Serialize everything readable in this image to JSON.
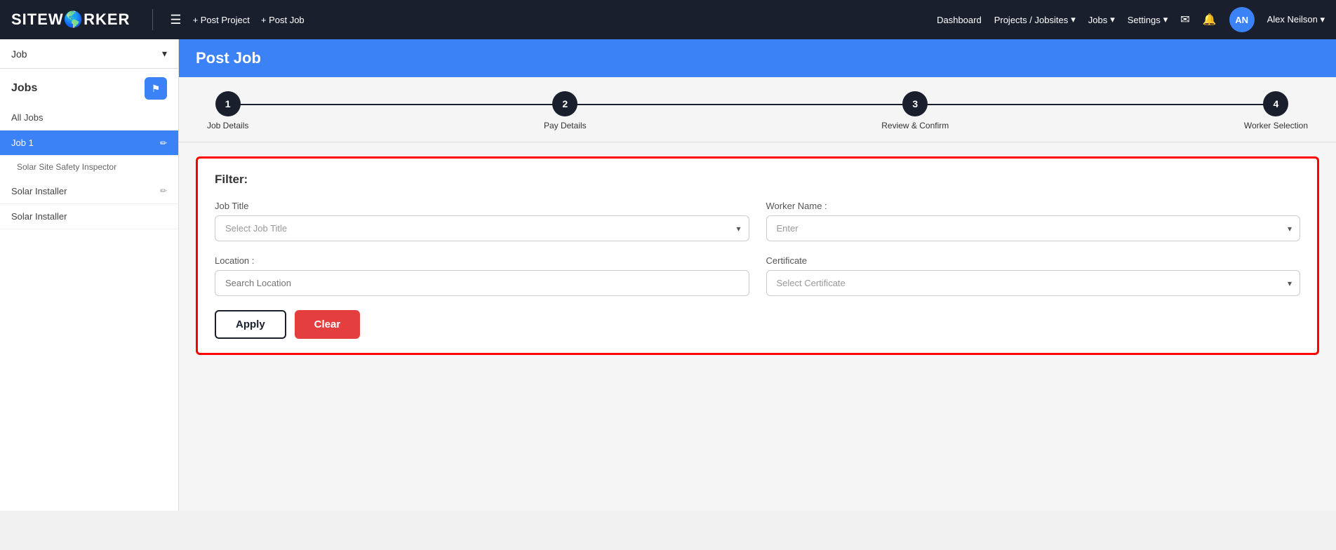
{
  "navbar": {
    "brand": "SITEW",
    "brand_colored": "O",
    "brand_rest": "RKER",
    "hamburger_icon": "☰",
    "post_project": "+ Post Project",
    "post_job": "+ Post Job",
    "dashboard": "Dashboard",
    "projects_jobsites": "Projects / Jobsites",
    "jobs": "Jobs",
    "settings": "Settings",
    "mail_icon": "✉",
    "bell_icon": "🔔",
    "avatar_initials": "AN",
    "username": "Alex Neilson",
    "chevron": "▾"
  },
  "sidebar": {
    "dropdown_label": "Job",
    "section_title": "Jobs",
    "filter_icon": "▼",
    "items": [
      {
        "label": "All Jobs",
        "active": false,
        "sub": null,
        "editable": false
      },
      {
        "label": "Job 1",
        "active": true,
        "sub": "Solar Site Safety Inspector",
        "editable": true
      },
      {
        "label": "Solar Installer",
        "active": false,
        "sub": null,
        "editable": true
      },
      {
        "label": "Solar Installer",
        "active": false,
        "sub": null,
        "editable": false
      }
    ]
  },
  "main": {
    "page_title": "Post Job",
    "steps": [
      {
        "number": "1",
        "label": "Job Details"
      },
      {
        "number": "2",
        "label": "Pay Details"
      },
      {
        "number": "3",
        "label": "Review & Confirm"
      },
      {
        "number": "4",
        "label": "Worker Selection"
      }
    ],
    "filter": {
      "title": "Filter:",
      "job_title_label": "Job Title",
      "job_title_placeholder": "Select Job Title",
      "worker_name_label": "Worker Name :",
      "worker_name_placeholder": "Enter",
      "location_label": "Location :",
      "location_placeholder": "Search Location",
      "certificate_label": "Certificate",
      "certificate_placeholder": "Select Certificate",
      "apply_label": "Apply",
      "clear_label": "Clear"
    }
  }
}
